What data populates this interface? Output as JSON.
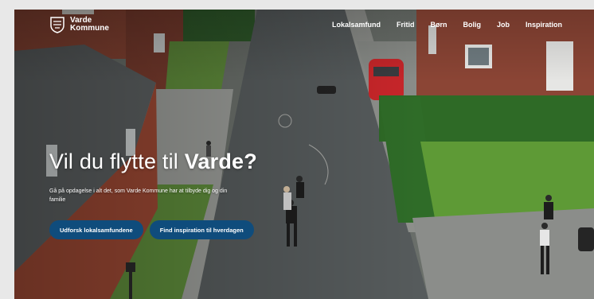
{
  "brand": {
    "line1": "Varde",
    "line2": "Kommune"
  },
  "nav": {
    "items": [
      {
        "label": "Lokalsamfund"
      },
      {
        "label": "Fritid"
      },
      {
        "label": "Børn"
      },
      {
        "label": "Bolig"
      },
      {
        "label": "Job"
      },
      {
        "label": "Inspiration"
      }
    ]
  },
  "hero": {
    "title_regular": "Vil du flytte til ",
    "title_bold": "Varde?",
    "subtitle": "Gå på opdagelse i alt det, som Varde Kommune har at tilbyde dig og din familie",
    "buttons": [
      {
        "label": "Udforsk lokalsamfundene"
      },
      {
        "label": "Find inspiration til hverdagen"
      }
    ]
  },
  "colors": {
    "button_bg": "#0f4c7c",
    "text": "#ffffff"
  },
  "icons": {
    "logo": "varde-coat-of-arms-icon"
  }
}
